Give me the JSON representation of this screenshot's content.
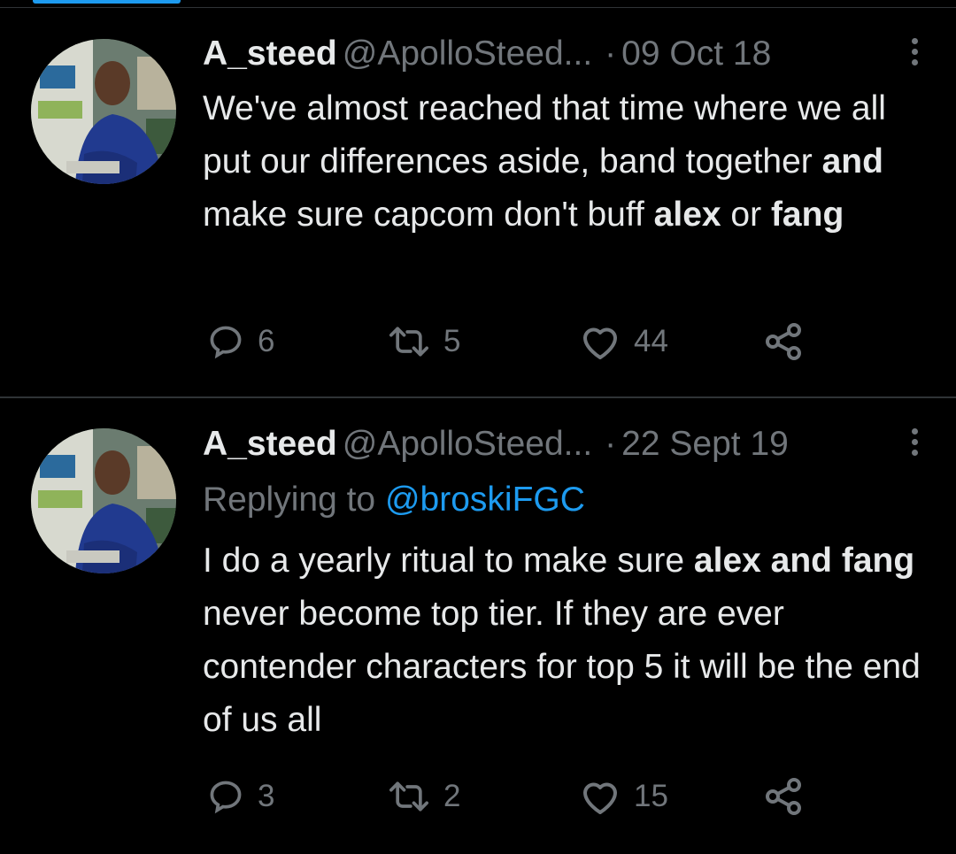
{
  "theme": {
    "background": "#000000",
    "text": "#e7e9ea",
    "muted": "#71767b",
    "link": "#1d9bf0",
    "divider": "#2f3336",
    "tab_indicator": "#1d9bf0"
  },
  "tweets": [
    {
      "display_name": "A_steed",
      "handle": "@ApolloSteed...",
      "dot": "·",
      "date": "09 Oct 18",
      "replying_to_label": "",
      "replying_to_handle": "",
      "body_segments": [
        {
          "text": "We've almost reached that time where we all put our differences aside, band together ",
          "bold": false
        },
        {
          "text": "and",
          "bold": true
        },
        {
          "text": " make sure capcom don't buff ",
          "bold": false
        },
        {
          "text": "alex",
          "bold": true
        },
        {
          "text": " or ",
          "bold": false
        },
        {
          "text": "fang",
          "bold": true
        }
      ],
      "reply_count": "6",
      "retweet_count": "5",
      "like_count": "44",
      "icons": [
        "avatar",
        "more-vertical-icon",
        "reply-icon",
        "retweet-icon",
        "like-icon",
        "share-icon"
      ]
    },
    {
      "display_name": "A_steed",
      "handle": "@ApolloSteed...",
      "dot": "·",
      "date": "22 Sept 19",
      "replying_to_label": "Replying to",
      "replying_to_handle": "@broskiFGC",
      "body_segments": [
        {
          "text": "I do a yearly ritual to make sure ",
          "bold": false
        },
        {
          "text": "alex and fang",
          "bold": true
        },
        {
          "text": " never become top tier. If they are ever contender characters for top 5 it will be the end of us all",
          "bold": false
        }
      ],
      "reply_count": "3",
      "retweet_count": "2",
      "like_count": "15",
      "icons": [
        "avatar",
        "more-vertical-icon",
        "reply-icon",
        "retweet-icon",
        "like-icon",
        "share-icon"
      ]
    }
  ]
}
